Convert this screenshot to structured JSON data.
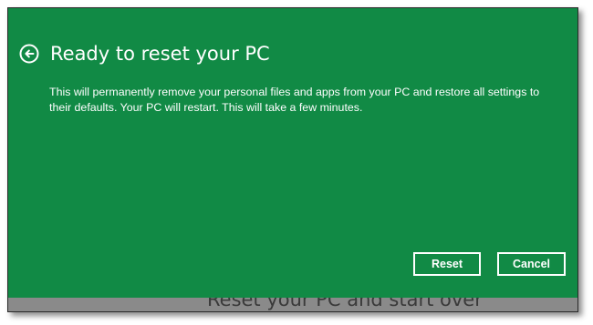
{
  "dialog": {
    "title": "Ready to reset your PC",
    "message": "This will permanently remove your personal files and apps from your PC and restore all settings to their defaults. Your PC will restart. This will take a few minutes.",
    "back_icon": "back-arrow-circle-icon",
    "reset_label": "Reset",
    "cancel_label": "Cancel"
  },
  "background_page": {
    "heading": "Reset your PC and start over"
  },
  "colors": {
    "dialog_background": "#118a45",
    "overlay_gray": "#8a8a8a",
    "text": "#ffffff"
  }
}
